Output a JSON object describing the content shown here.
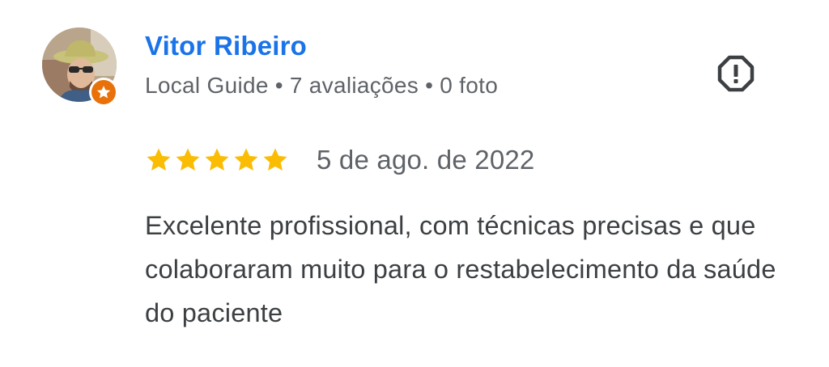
{
  "reviewer": {
    "name": "Vitor Ribeiro",
    "badge": "Local Guide",
    "reviews_count": "7 avaliações",
    "photos_count": "0 foto",
    "separator": "•"
  },
  "review": {
    "rating": 5,
    "max_rating": 5,
    "date": "5 de ago. de 2022",
    "text": "Excelente profissional, com técnicas precisas e que colaboraram muito para o restabelecimento da saúde do paciente"
  },
  "icons": {
    "avatar": "avatar-photo",
    "guide_badge": "star-badge-icon",
    "report": "report-icon",
    "star": "star-icon"
  },
  "colors": {
    "name": "#1a73e8",
    "meta": "#5f6368",
    "text": "#3c4043",
    "star": "#fbbc04",
    "badge": "#e8710a",
    "report_icon": "#3c4043"
  }
}
